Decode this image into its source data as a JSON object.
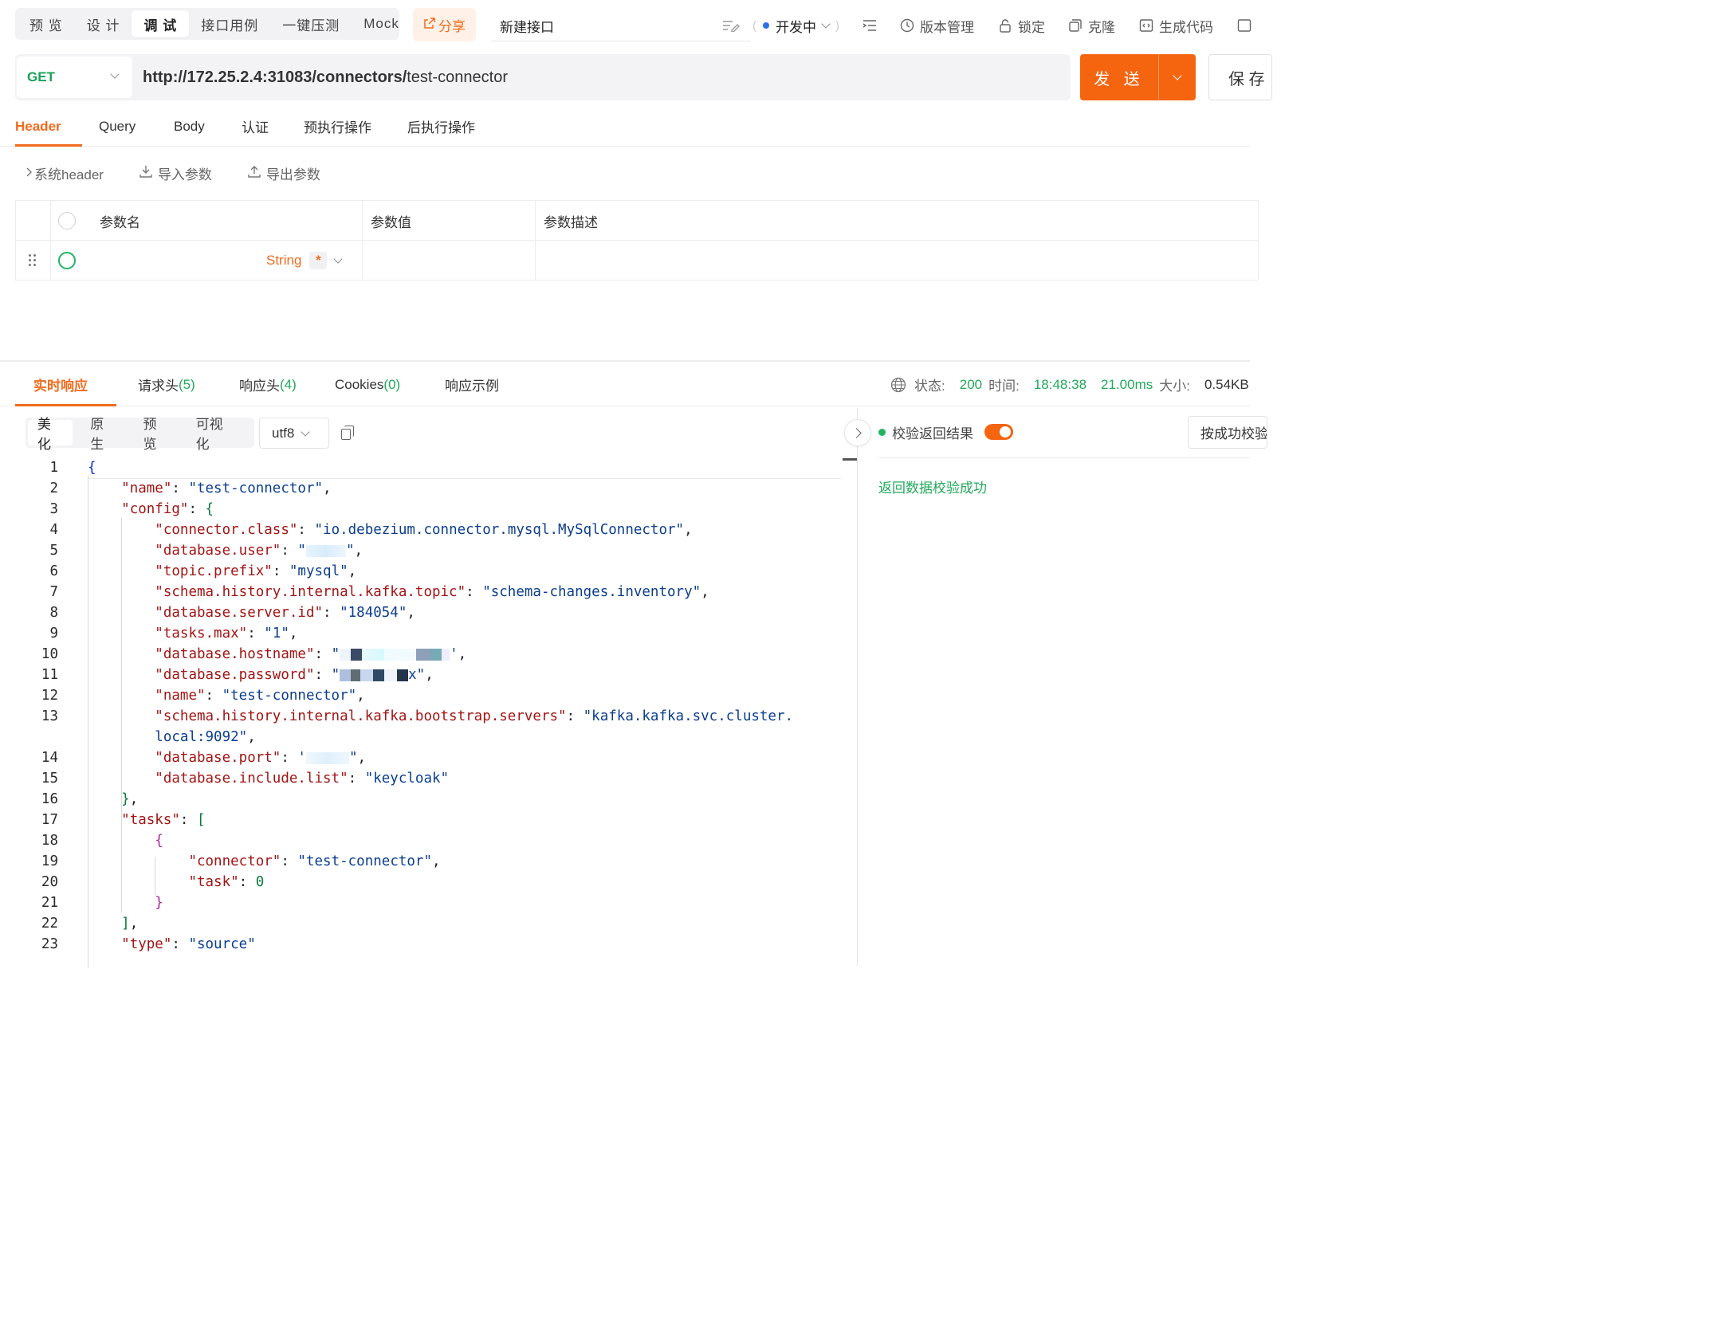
{
  "mode_tabs": [
    "预 览",
    "设 计",
    "调 试",
    "接口用例",
    "一键压测",
    "Mock"
  ],
  "active_mode": "调 试",
  "share_label": "分享",
  "api_name": "新建接口",
  "status": "开发中",
  "toolbar": {
    "version": "版本管理",
    "lock": "锁定",
    "clone": "克隆",
    "gen_code": "生成代码"
  },
  "request": {
    "method": "GET",
    "url_base": "http://172.25.2.4:31083/connectors/",
    "url_path": "test-connector",
    "send_label": "发 送",
    "save_label": "保 存"
  },
  "req_tabs": [
    "Header",
    "Query",
    "Body",
    "认证",
    "预执行操作",
    "后执行操作"
  ],
  "header_actions": {
    "system_header": "系统header",
    "import": "导入参数",
    "export": "导出参数"
  },
  "param_table": {
    "columns": [
      "参数名",
      "参数值",
      "参数描述"
    ],
    "row": {
      "type": "String",
      "required_mark": "*"
    }
  },
  "resp_tabs": {
    "realtime": "实时响应",
    "req_headers": "请求头",
    "req_headers_count": "(5)",
    "resp_headers": "响应头",
    "resp_headers_count": "(4)",
    "cookies": "Cookies",
    "cookies_count": "(0)",
    "example": "响应示例"
  },
  "resp_meta": {
    "status_label": "状态:",
    "status_value": "200",
    "time_label": "时间:",
    "time_value": "18:48:38",
    "duration": "21.00ms",
    "size_label": "大小:",
    "size_value": "0.54KB"
  },
  "view_tabs": [
    "美化",
    "原生",
    "预览",
    "可视化"
  ],
  "encoding": "utf8",
  "verify": {
    "label": "校验返回结果",
    "mode": "按成功校验",
    "message": "返回数据校验成功"
  },
  "code_lines": [
    "1",
    "2",
    "3",
    "4",
    "5",
    "6",
    "7",
    "8",
    "9",
    "10",
    "11",
    "12",
    "13",
    "14",
    "15",
    "16",
    "17",
    "18",
    "19",
    "20",
    "21",
    "22",
    "23"
  ],
  "colors": {
    "accent": "#f5650f",
    "success": "#21a95b",
    "method_get": "#1aa156"
  }
}
